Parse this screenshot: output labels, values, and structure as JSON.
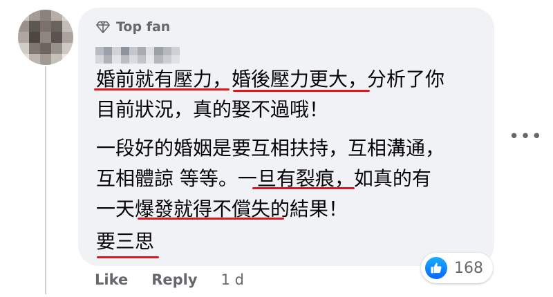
{
  "comment": {
    "badge_label": "Top fan",
    "paragraphs": [
      [
        "婚前就有壓力，婚後壓力更大，分析了你",
        "目前狀況，真的娶不過哦！"
      ],
      [
        "一段好的婚姻是要互相扶持，互相溝通，",
        "互相體諒 等等。一旦有裂痕，如真的有",
        "一天爆發就得不償失的結果！"
      ],
      [
        "要三思"
      ]
    ],
    "highlight_color": "#e0161e"
  },
  "reactions": {
    "count": "168",
    "icon": "thumbs-up-icon"
  },
  "actions": {
    "like": "Like",
    "reply": "Reply",
    "time": "1 d"
  },
  "menu": {
    "more_label": "•••"
  },
  "colors": {
    "bubble": "#f0f2f5",
    "secondary_text": "#65676b",
    "like_blue": "#0866ff"
  }
}
